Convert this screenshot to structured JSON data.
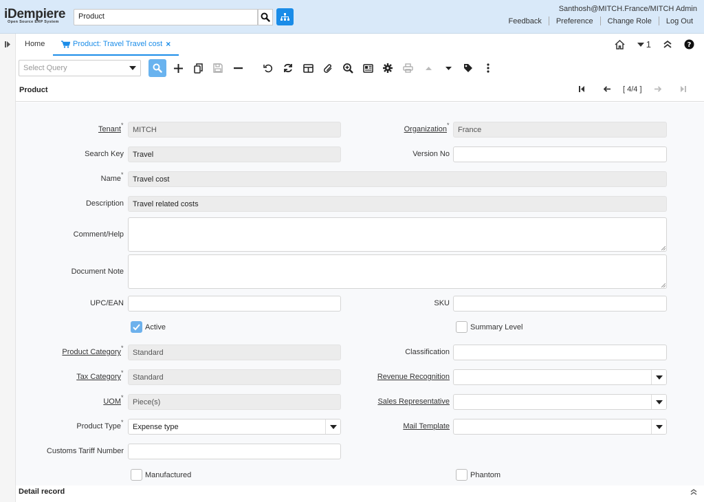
{
  "header": {
    "logo_main": "iDempiere",
    "logo_sub": "Open Source ERP System",
    "search_value": "Product",
    "user": "Santhosh@MITCH.France/MITCH Admin",
    "links": [
      "Feedback",
      "Preference",
      "Change Role",
      "Log Out"
    ]
  },
  "tabs": {
    "home": "Home",
    "active": "Product: Travel Travel cost",
    "close": "×",
    "window_count": "1"
  },
  "toolbar": {
    "query_placeholder": "Select Query"
  },
  "section": {
    "title": "Product",
    "record_nav": "[ 4/4 ]"
  },
  "form": {
    "tenant": {
      "label": "Tenant",
      "value": "MITCH"
    },
    "organization": {
      "label": "Organization",
      "value": "France"
    },
    "search_key": {
      "label": "Search Key",
      "value": "Travel"
    },
    "version_no": {
      "label": "Version No",
      "value": ""
    },
    "name": {
      "label": "Name",
      "value": "Travel cost"
    },
    "description": {
      "label": "Description",
      "value": "Travel related costs"
    },
    "comment_help": {
      "label": "Comment/Help",
      "value": ""
    },
    "document_note": {
      "label": "Document Note",
      "value": ""
    },
    "upc_ean": {
      "label": "UPC/EAN",
      "value": ""
    },
    "sku": {
      "label": "SKU",
      "value": ""
    },
    "active": {
      "label": "Active",
      "checked": true
    },
    "summary_level": {
      "label": "Summary Level",
      "checked": false
    },
    "product_category": {
      "label": "Product Category",
      "value": "Standard"
    },
    "classification": {
      "label": "Classification",
      "value": ""
    },
    "tax_category": {
      "label": "Tax Category",
      "value": "Standard"
    },
    "revenue_recognition": {
      "label": "Revenue Recognition",
      "value": ""
    },
    "uom": {
      "label": "UOM",
      "value": "Piece(s)"
    },
    "sales_representative": {
      "label": "Sales Representative",
      "value": ""
    },
    "product_type": {
      "label": "Product Type",
      "value": "Expense type"
    },
    "mail_template": {
      "label": "Mail Template",
      "value": ""
    },
    "customs_tariff": {
      "label": "Customs Tariff Number",
      "value": ""
    },
    "manufactured": {
      "label": "Manufactured",
      "checked": false
    },
    "phantom": {
      "label": "Phantom",
      "checked": false
    }
  },
  "detail": {
    "title": "Detail record"
  },
  "colors": {
    "accent": "#1a8ce8",
    "header_bg": "#d9e9f9"
  }
}
